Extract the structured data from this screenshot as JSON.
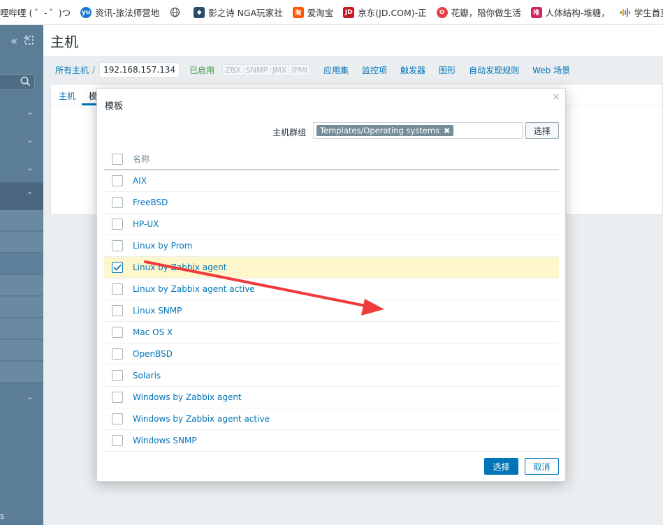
{
  "bookmarks": [
    {
      "label": "哩哔哩 ( ゜- ゜)つ",
      "icon": "bilibili-icon",
      "color": "#ffffff"
    },
    {
      "label": "资讯-旅法师营地",
      "icon": "yingdi-icon",
      "color": "#1e78d2"
    },
    {
      "label": "",
      "icon": "globe-icon",
      "color": "#555555"
    },
    {
      "label": "影之诗 NGA玩家社",
      "icon": "nga-icon",
      "color": "#2c4c6c"
    },
    {
      "label": "爱淘宝",
      "icon": "taobao-icon",
      "color": "#ff5500"
    },
    {
      "label": "京东(JD.COM)-正",
      "icon": "jd-icon",
      "color": "#c81623"
    },
    {
      "label": "花瓣，陪你做生活",
      "icon": "huaban-icon",
      "color": "#e6414b"
    },
    {
      "label": "人体结构-堆糖，",
      "icon": "duitang-icon",
      "color": "#d2245f"
    },
    {
      "label": "学生首页_在线学",
      "icon": "audio-bars-icon",
      "color": "#4caf50"
    }
  ],
  "sidebar": {
    "bottom_text": "s"
  },
  "page": {
    "title": "主机"
  },
  "breadcrumb": {
    "all_hosts": "所有主机",
    "separator": "/",
    "current_host": "192.168.157.134",
    "status": "已启用",
    "protocols": [
      "ZBX",
      "SNMP",
      "JMX",
      "IPMI"
    ],
    "links": [
      "应用集",
      "监控项",
      "触发器",
      "图形",
      "自动发现规则",
      "Web 场景"
    ]
  },
  "host_tabs": {
    "host": "主机",
    "templates_partial": "模"
  },
  "modal": {
    "title": "模板",
    "close_glyph": "×",
    "filter_label": "主机群组",
    "filter_tag": "Templates/Operating systems",
    "filter_tag_remove": "✖",
    "select_button": "选择",
    "column_name": "名称",
    "rows": [
      {
        "label": "AIX",
        "checked": false
      },
      {
        "label": "FreeBSD",
        "checked": false
      },
      {
        "label": "HP-UX",
        "checked": false
      },
      {
        "label": "Linux by Prom",
        "checked": false
      },
      {
        "label": "Linux by Zabbix agent",
        "checked": true
      },
      {
        "label": "Linux by Zabbix agent active",
        "checked": false
      },
      {
        "label": "Linux SNMP",
        "checked": false
      },
      {
        "label": "Mac OS X",
        "checked": false
      },
      {
        "label": "OpenBSD",
        "checked": false
      },
      {
        "label": "Solaris",
        "checked": false
      },
      {
        "label": "Windows by Zabbix agent",
        "checked": false
      },
      {
        "label": "Windows by Zabbix agent active",
        "checked": false
      },
      {
        "label": "Windows SNMP",
        "checked": false
      }
    ],
    "confirm_button": "选择",
    "cancel_button": "取消"
  },
  "colors": {
    "link": "#0275b8",
    "sidebar": "#5c7d96",
    "selected_row": "#fef6cc",
    "enabled": "#429e47",
    "annotation_arrow": "#ee3b3b"
  }
}
